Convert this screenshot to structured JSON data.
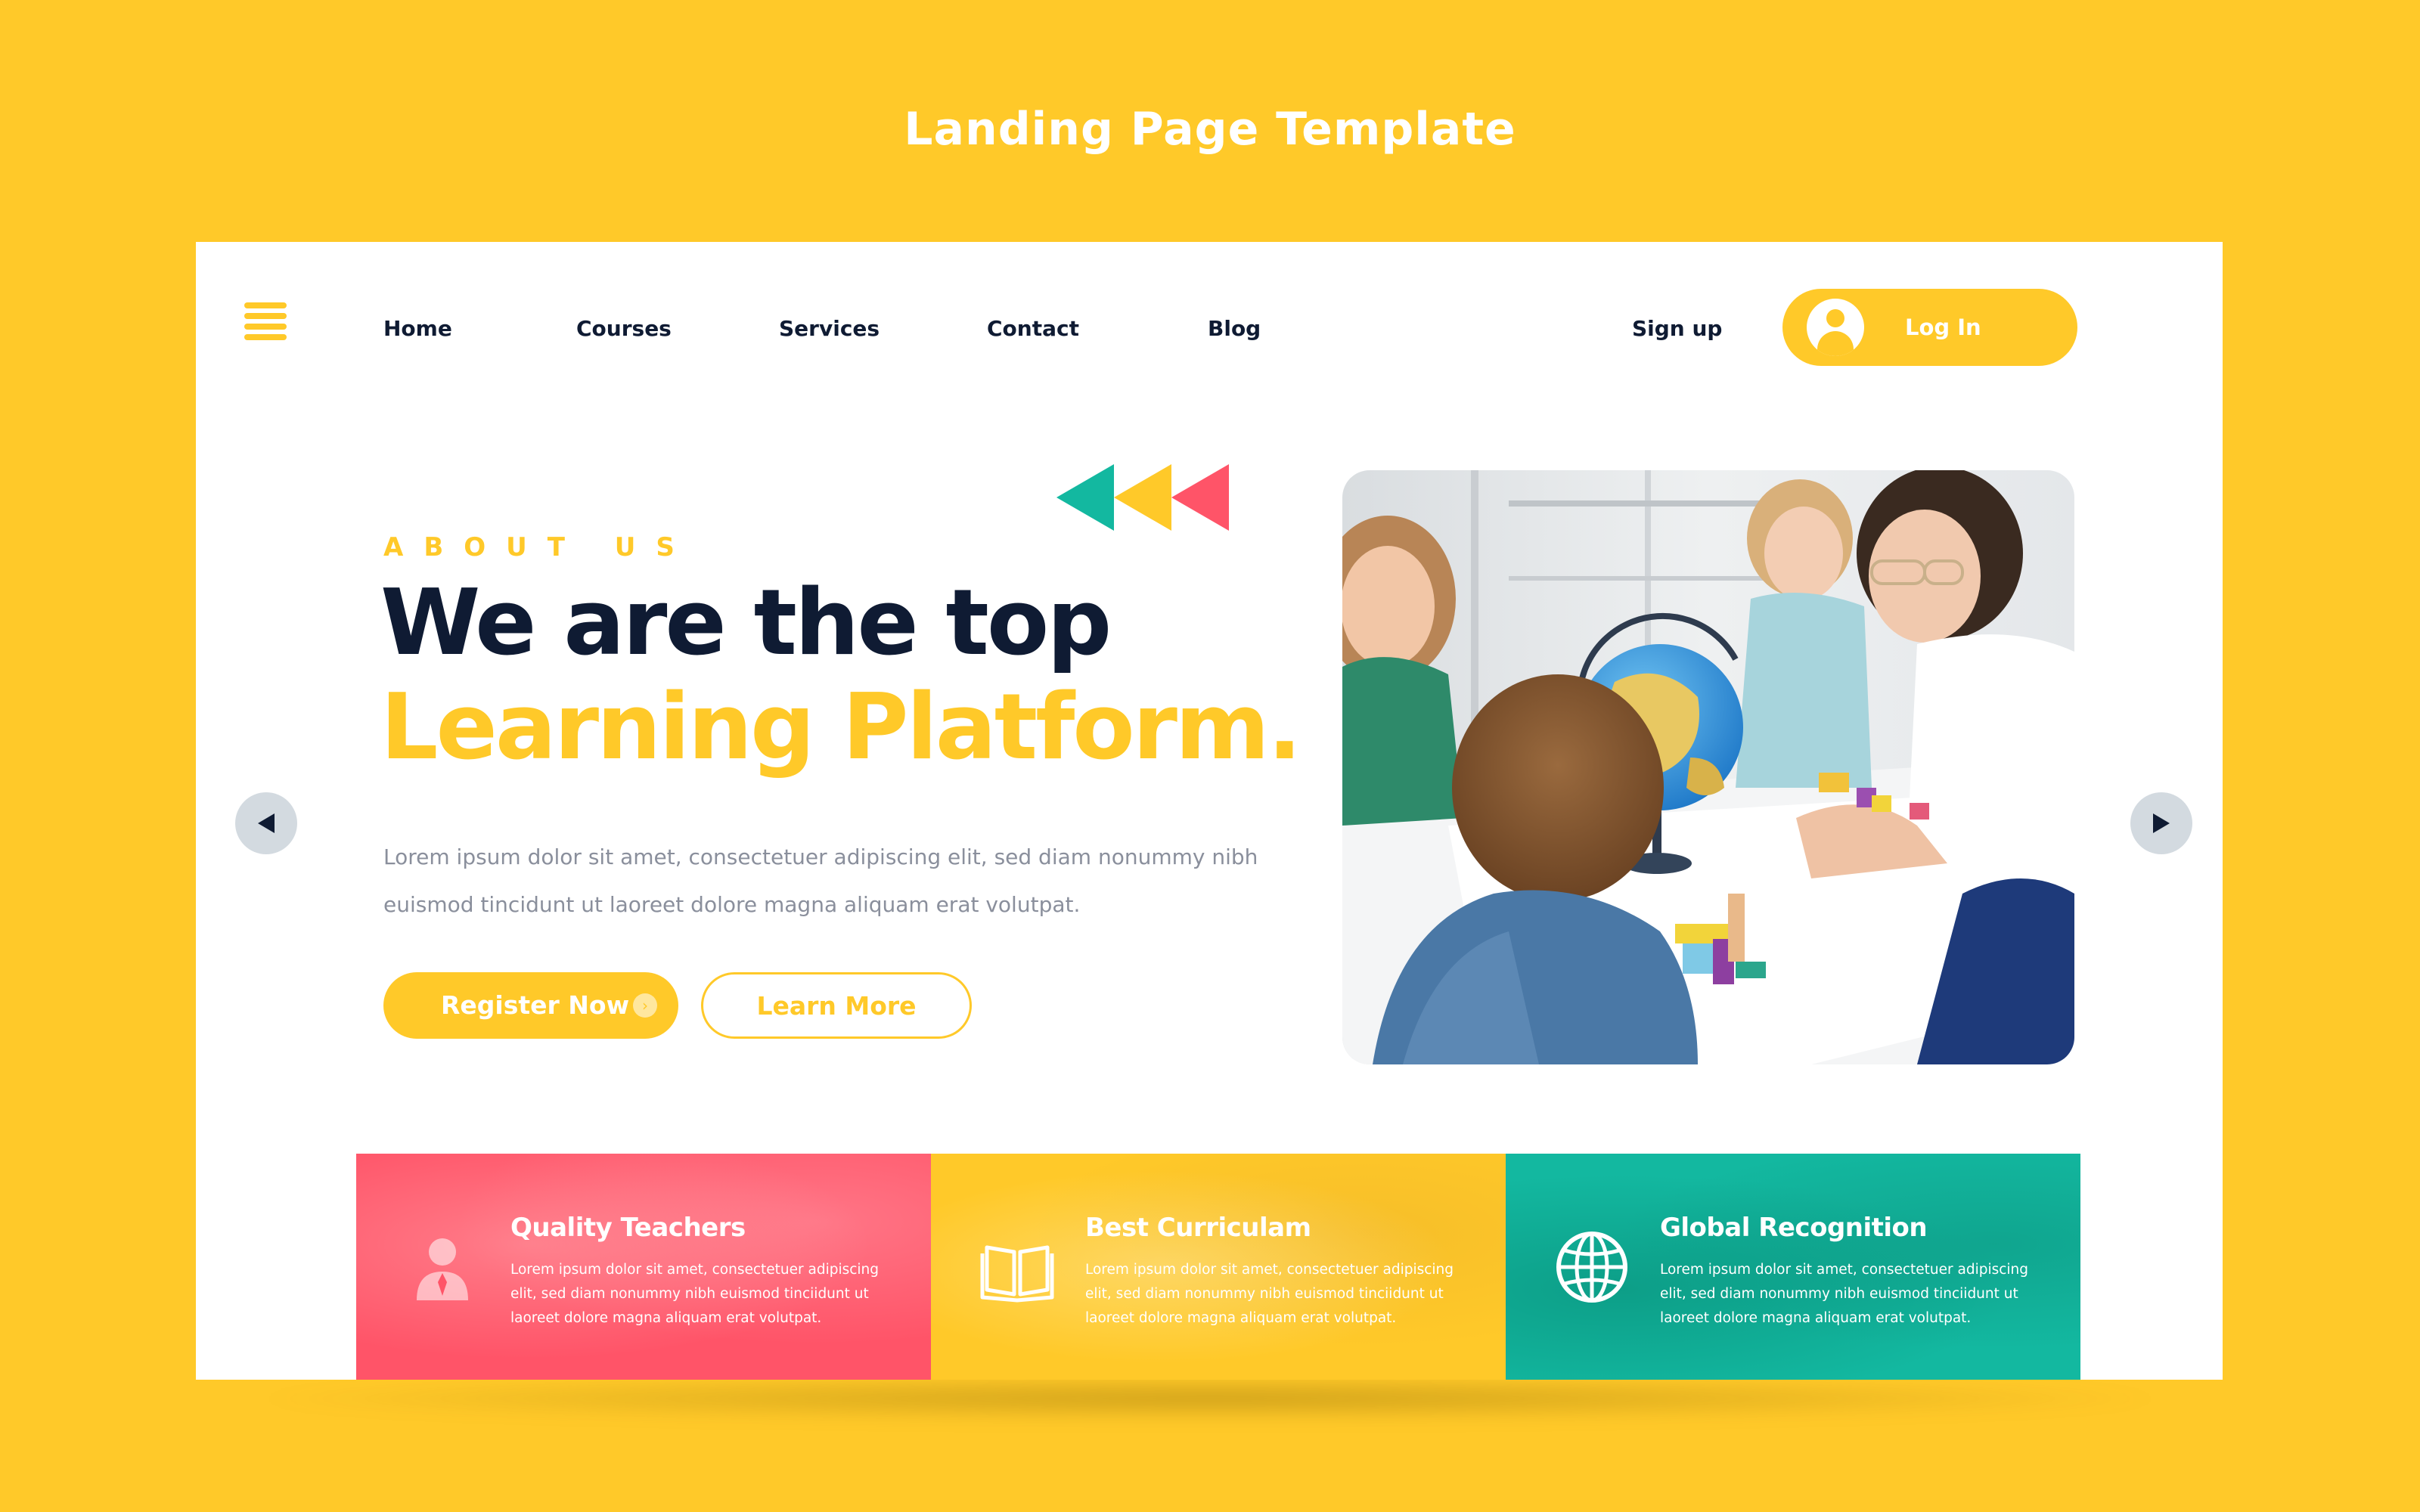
{
  "page": {
    "title": "Landing Page Template"
  },
  "nav": {
    "links": [
      "Home",
      "Courses",
      "Services",
      "Contact",
      "Blog"
    ],
    "signup": "Sign up",
    "login": "Log In"
  },
  "hero": {
    "eyebrow": "ABOUT US",
    "headline_line1": "We are the top",
    "headline_line2": "Learning Platform.",
    "description": "Lorem ipsum dolor sit amet, consectetuer adipiscing elit, sed diam nonummy nibh euismod tincidunt ut laoreet dolore magna aliquam erat volutpat.",
    "register_label": "Register Now",
    "learn_label": "Learn More"
  },
  "features": [
    {
      "title": "Quality Teachers",
      "text": "Lorem ipsum dolor sit amet, consectetuer adipiscing elit, sed diam nonummy nibh euismod tinciidunt ut laoreet dolore magna aliquam erat volutpat.",
      "icon": "teacher-icon",
      "color": "#FF5468"
    },
    {
      "title": "Best Curriculam",
      "text": "Lorem ipsum dolor sit amet, consectetuer adipiscing elit, sed diam nonummy nibh euismod tinciidunt ut laoreet dolore magna aliquam erat volutpat.",
      "icon": "book-icon",
      "color": "#FFC929"
    },
    {
      "title": "Global Recognition",
      "text": "Lorem ipsum dolor sit amet, consectetuer adipiscing elit, sed diam nonummy nibh euismod tinciidunt ut laoreet dolore magna aliquam erat volutpat.",
      "icon": "globe-icon",
      "color": "#13B8A0"
    }
  ],
  "colors": {
    "brand_yellow": "#FFC929",
    "dark_navy": "#0F1B33",
    "coral": "#FF5468",
    "teal": "#13B8A0",
    "arrow_grey": "#D3DAE0"
  }
}
